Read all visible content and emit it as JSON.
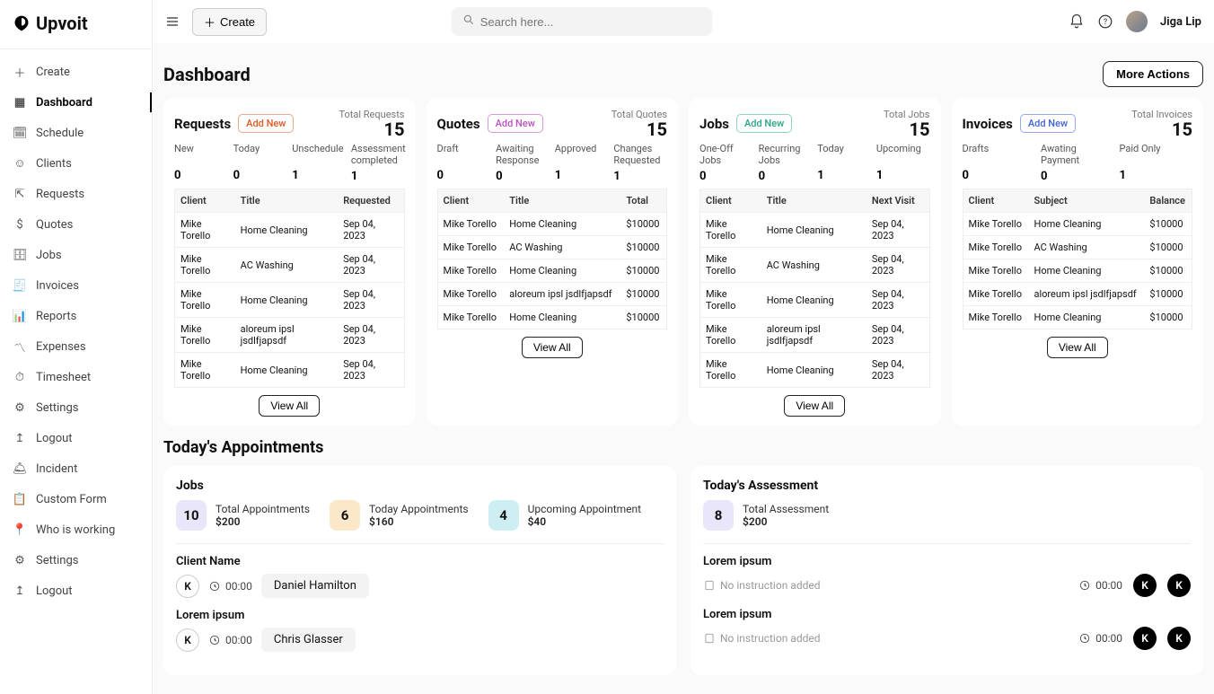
{
  "brand": "Upvoit",
  "sidebar": {
    "create": "Create",
    "items": [
      {
        "label": "Dashboard",
        "active": true
      },
      {
        "label": "Schedule"
      },
      {
        "label": "Clients"
      },
      {
        "label": "Requests"
      },
      {
        "label": "Quotes"
      },
      {
        "label": "Jobs"
      },
      {
        "label": "Invoices"
      },
      {
        "label": "Reports"
      },
      {
        "label": "Expenses"
      },
      {
        "label": "Timesheet"
      },
      {
        "label": "Settings"
      },
      {
        "label": "Logout"
      },
      {
        "label": "Incident"
      },
      {
        "label": "Custom Form"
      },
      {
        "label": "Who is working"
      },
      {
        "label": "Settings"
      },
      {
        "label": "Logout"
      }
    ]
  },
  "topbar": {
    "create": "Create",
    "search_placeholder": "Search here...",
    "username": "Jiga Lip"
  },
  "page": {
    "title": "Dashboard",
    "more_actions": "More Actions"
  },
  "cards": [
    {
      "title": "Requests",
      "add": "Add New",
      "addclass": "red",
      "total_label": "Total Requests",
      "total": "15",
      "stats": [
        {
          "lbl": "New",
          "val": "0"
        },
        {
          "lbl": "Today",
          "val": "0"
        },
        {
          "lbl": "Unschedule",
          "val": "1"
        },
        {
          "lbl": "Assessment completed",
          "val": "1"
        }
      ],
      "headers": [
        "Client",
        "Title",
        "Requested"
      ],
      "rows": [
        [
          "Mike Torello",
          "Home Cleaning",
          "Sep 04, 2023"
        ],
        [
          "Mike Torello",
          "AC Washing",
          "Sep 04, 2023"
        ],
        [
          "Mike Torello",
          "Home Cleaning",
          "Sep 04, 2023"
        ],
        [
          "Mike Torello",
          "aloreum ipsl jsdlfjapsdf",
          "Sep 04, 2023"
        ],
        [
          "Mike Torello",
          "Home Cleaning",
          "Sep 04, 2023"
        ]
      ],
      "viewall": "View All"
    },
    {
      "title": "Quotes",
      "add": "Add New",
      "addclass": "purple",
      "total_label": "Total Quotes",
      "total": "15",
      "stats": [
        {
          "lbl": "Draft",
          "val": "0"
        },
        {
          "lbl": "Awaiting Response",
          "val": "0"
        },
        {
          "lbl": "Approved",
          "val": "1"
        },
        {
          "lbl": "Changes Requested",
          "val": "1"
        }
      ],
      "headers": [
        "Client",
        "Title",
        "Total"
      ],
      "rows": [
        [
          "Mike Torello",
          "Home Cleaning",
          "$10000"
        ],
        [
          "Mike Torello",
          "AC Washing",
          "$10000"
        ],
        [
          "Mike Torello",
          "Home Cleaning",
          "$10000"
        ],
        [
          "Mike Torello",
          "aloreum ipsl jsdlfjapsdf",
          "$10000"
        ],
        [
          "Mike Torello",
          "Home Cleaning",
          "$10000"
        ]
      ],
      "viewall": "View All"
    },
    {
      "title": "Jobs",
      "add": "Add New",
      "addclass": "teal",
      "total_label": "Total Jobs",
      "total": "15",
      "stats": [
        {
          "lbl": "One-Off Jobs",
          "val": "0"
        },
        {
          "lbl": "Recurring Jobs",
          "val": "0"
        },
        {
          "lbl": "Today",
          "val": "1"
        },
        {
          "lbl": "Upcoming",
          "val": "1"
        }
      ],
      "headers": [
        "Client",
        "Title",
        "Next Visit"
      ],
      "rows": [
        [
          "Mike Torello",
          "Home Cleaning",
          "Sep 04, 2023"
        ],
        [
          "Mike Torello",
          "AC Washing",
          "Sep 04, 2023"
        ],
        [
          "Mike Torello",
          "Home Cleaning",
          "Sep 04, 2023"
        ],
        [
          "Mike Torello",
          "aloreum ipsl jsdlfjapsdf",
          "Sep 04, 2023"
        ],
        [
          "Mike Torello",
          "Home Cleaning",
          "Sep 04, 2023"
        ]
      ],
      "viewall": "View All"
    },
    {
      "title": "Invoices",
      "add": "Add New",
      "addclass": "blue",
      "total_label": "Total Invoices",
      "total": "15",
      "stats": [
        {
          "lbl": "Drafts",
          "val": "0"
        },
        {
          "lbl": "Awating Payment",
          "val": "0"
        },
        {
          "lbl": "Paid Only",
          "val": "1"
        }
      ],
      "headers": [
        "Client",
        "Subject",
        "Balance"
      ],
      "rows": [
        [
          "Mike Torello",
          "Home Cleaning",
          "$10000"
        ],
        [
          "Mike Torello",
          "AC Washing",
          "$10000"
        ],
        [
          "Mike Torello",
          "Home Cleaning",
          "$10000"
        ],
        [
          "Mike Torello",
          "aloreum ipsl jsdlfjapsdf",
          "$10000"
        ],
        [
          "Mike Torello",
          "Home Cleaning",
          "$10000"
        ]
      ],
      "viewall": "View All"
    }
  ],
  "appointments": {
    "section": "Today's Appointments",
    "jobs": {
      "title": "Jobs",
      "metrics": [
        {
          "num": "10",
          "label": "Total Appointments",
          "amount": "$200",
          "cls": "b1"
        },
        {
          "num": "6",
          "label": "Today Appointments",
          "amount": "$160",
          "cls": "b2"
        },
        {
          "num": "4",
          "label": "Upcoming Appointment",
          "amount": "$40",
          "cls": "b3"
        }
      ],
      "items": [
        {
          "name": "Client Name",
          "time": "00:00",
          "person": "Daniel Hamilton",
          "k": "K"
        },
        {
          "name": "Lorem ipsum",
          "time": "00:00",
          "person": "Chris Glasser",
          "k": "K"
        }
      ]
    },
    "assess": {
      "title": "Today's Assessment",
      "metric": {
        "num": "8",
        "label": "Total Assessment",
        "amount": "$200",
        "cls": "b1"
      },
      "items": [
        {
          "name": "Lorem ipsum",
          "note": "No instruction added",
          "time": "00:00",
          "k": "K"
        },
        {
          "name": "Lorem ipsum",
          "note": "No instruction added",
          "time": "00:00",
          "k": "K"
        }
      ]
    }
  }
}
